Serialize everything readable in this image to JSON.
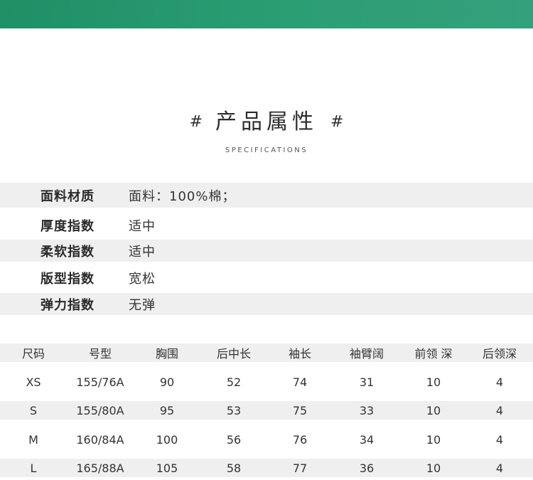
{
  "header": {
    "hash_left": "#",
    "title": "产品属性",
    "hash_right": "#",
    "subtitle": "SPECIFICATIONS",
    "accent_color": "#2c9e74"
  },
  "specs": [
    {
      "label": "面料材质",
      "value": "面料：100%棉；"
    },
    {
      "label": "厚度指数",
      "value": "适中"
    },
    {
      "label": "柔软指数",
      "value": "适中"
    },
    {
      "label": "版型指数",
      "value": "宽松"
    },
    {
      "label": "弹力指数",
      "value": "无弹"
    }
  ],
  "size_table": {
    "headers": [
      "尺码",
      "号型",
      "胸围",
      "后中长",
      "袖长",
      "袖臂阔",
      "前领 深",
      "后领深"
    ],
    "rows": [
      [
        "XS",
        "155/76A",
        "90",
        "52",
        "74",
        "31",
        "10",
        "4"
      ],
      [
        "S",
        "155/80A",
        "95",
        "53",
        "75",
        "33",
        "10",
        "4"
      ],
      [
        "M",
        "160/84A",
        "100",
        "56",
        "76",
        "34",
        "10",
        "4"
      ],
      [
        "L",
        "165/88A",
        "105",
        "58",
        "77",
        "36",
        "10",
        "4"
      ]
    ]
  }
}
